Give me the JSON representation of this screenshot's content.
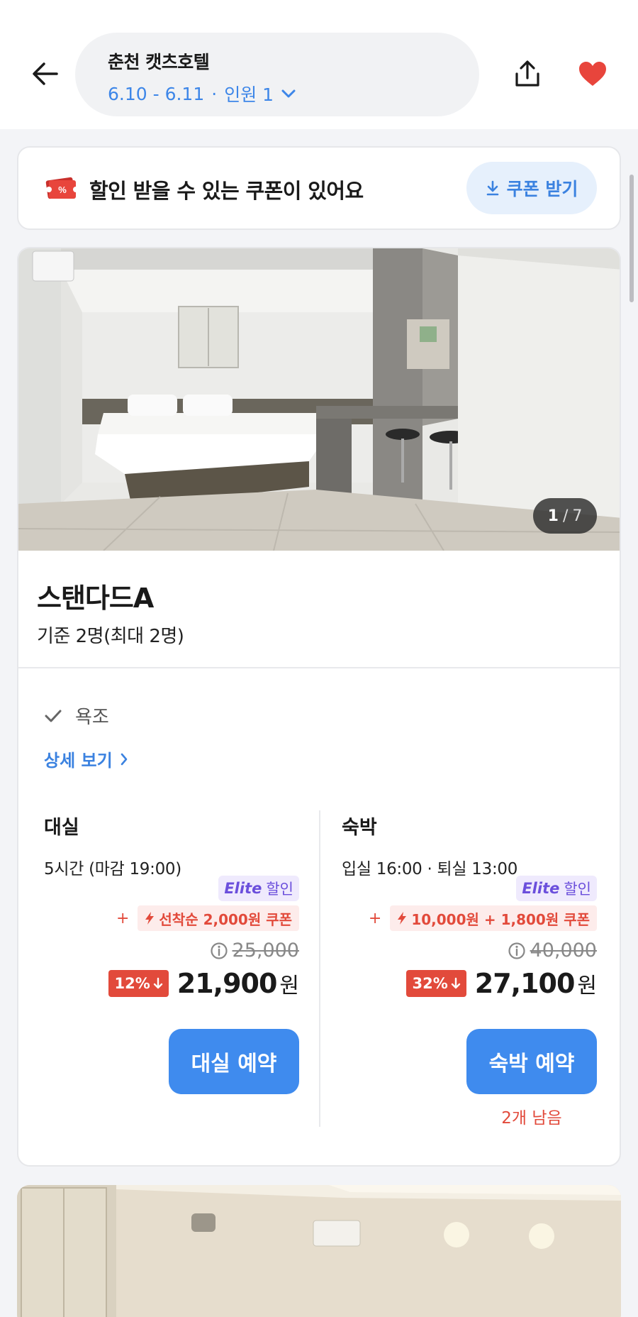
{
  "header": {
    "hotel_name": "춘천 캣츠호텔",
    "dates": "6.10 - 6.11",
    "separator": "·",
    "guests": "인원 1"
  },
  "coupon_banner": {
    "text": "할인 받을 수 있는 쿠폰이 있어요",
    "button_label": "쿠폰 받기"
  },
  "room": {
    "photo_index": "1",
    "photo_total": "7",
    "name": "스탠다드A",
    "capacity": "기준 2명(최대 2명)",
    "amenity": "욕조",
    "detail_link": "상세 보기",
    "rates": [
      {
        "title": "대실",
        "subtitle": "5시간 (마감 19:00)",
        "elite_brand": "Elite",
        "elite_label": "할인",
        "plus": "+",
        "coupon": "선착순 2,000원 쿠폰",
        "original_price": "25,000",
        "discount": "12%",
        "final_price": "21,900",
        "currency": "원",
        "button": "대실 예약"
      },
      {
        "title": "숙박",
        "subtitle": "입실 16:00 · 퇴실 13:00",
        "elite_brand": "Elite",
        "elite_label": "할인",
        "plus": "+",
        "coupon": "10,000원 + 1,800원 쿠폰",
        "original_price": "40,000",
        "discount": "32%",
        "final_price": "27,100",
        "currency": "원",
        "button": "숙박 예약",
        "remaining": "2개 남음"
      }
    ]
  },
  "icons": {
    "back": "arrow-left-icon",
    "share": "share-icon",
    "favorite": "heart-icon",
    "coupon": "coupon-ticket-icon",
    "download": "download-icon",
    "check": "check-icon",
    "chevron": "chevron-right-icon",
    "bolt": "bolt-icon",
    "info": "info-icon",
    "arrow_down": "arrow-down-icon"
  },
  "colors": {
    "accent_blue": "#3f8bee",
    "discount_red": "#e24a3b",
    "elite_purple": "#6b4fdc",
    "heart_red": "#e8453c"
  }
}
